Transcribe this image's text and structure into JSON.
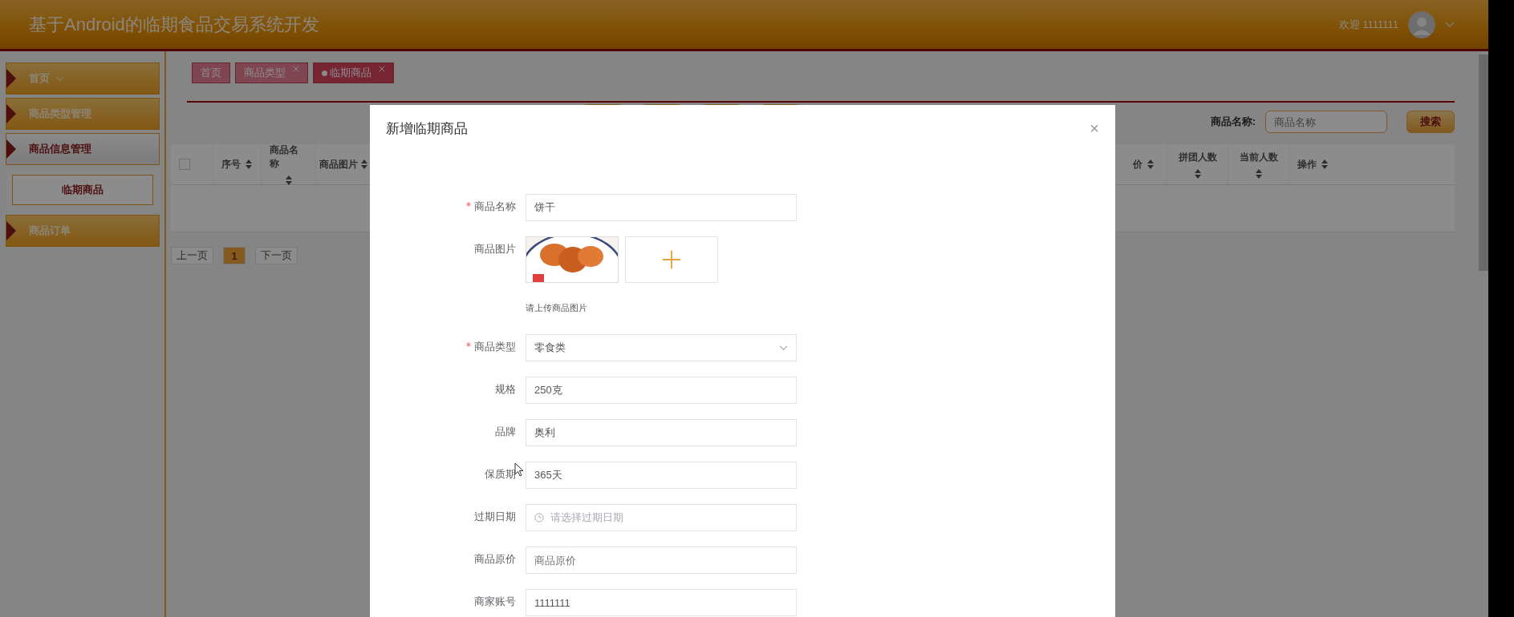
{
  "header": {
    "title": "基于Android的临期食品交易系统开发",
    "welcome": "欢迎 1111111"
  },
  "sidebar": {
    "items": [
      {
        "label": "首页",
        "selected": false,
        "has_caret": true
      },
      {
        "label": "商品类型管理",
        "selected": false,
        "has_caret": false
      },
      {
        "label": "商品信息管理",
        "selected": true,
        "has_caret": false,
        "children": [
          {
            "label": "临期商品",
            "selected": true
          }
        ]
      },
      {
        "label": "商品订单",
        "selected": false,
        "has_caret": false
      }
    ]
  },
  "tabs": [
    {
      "label": "首页",
      "closable": false,
      "selected": false
    },
    {
      "label": "商品类型",
      "closable": true,
      "selected": false
    },
    {
      "label": "临期商品",
      "closable": true,
      "selected": true
    }
  ],
  "search": {
    "label": "商品名称:",
    "placeholder": "商品名称",
    "button": "搜索"
  },
  "table": {
    "header_checkbox": {
      "checked": false
    },
    "columns": [
      {
        "label": "序号"
      },
      {
        "label": "商品名称"
      },
      {
        "label": "商品图片"
      },
      {
        "label": "价"
      },
      {
        "label": "拼团人数"
      },
      {
        "label": "当前人数"
      },
      {
        "label": "操作"
      }
    ]
  },
  "pagination": {
    "prev": "上一页",
    "pages": [
      {
        "label": "1",
        "selected": true
      }
    ],
    "next": "下一页"
  },
  "modal": {
    "title": "新增临期商品",
    "close": "×",
    "fields": [
      {
        "kind": "text",
        "label": "商品名称",
        "required": true,
        "value": "饼干"
      },
      {
        "kind": "image",
        "label": "商品图片",
        "required": false,
        "hint": "请上传商品图片"
      },
      {
        "kind": "select",
        "label": "商品类型",
        "required": true,
        "value": "零食类"
      },
      {
        "kind": "text",
        "label": "规格",
        "required": false,
        "value": "250克"
      },
      {
        "kind": "text",
        "label": "品牌",
        "required": false,
        "value": "奥利"
      },
      {
        "kind": "text",
        "label": "保质期",
        "required": false,
        "value": "365天"
      },
      {
        "kind": "date",
        "label": "过期日期",
        "required": false,
        "placeholder": "请选择过期日期"
      },
      {
        "kind": "text",
        "label": "商品原价",
        "required": false,
        "placeholder": "商品原价"
      },
      {
        "kind": "text",
        "label": "商家账号",
        "required": false,
        "value": "1111111"
      }
    ]
  }
}
